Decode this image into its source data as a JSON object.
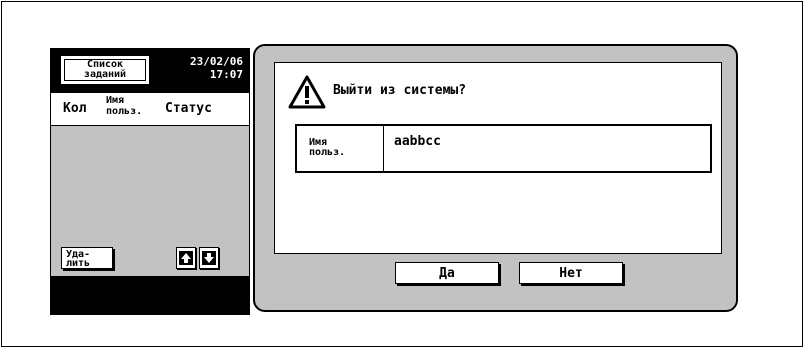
{
  "job_panel": {
    "job_list_label_line1": "Список",
    "job_list_label_line2": "заданий",
    "date": "23/02/06",
    "time": "17:07",
    "columns": {
      "count": "Кол",
      "user_line1": "Имя",
      "user_line2": "польз.",
      "status": "Статус"
    },
    "delete_line1": "Уда-",
    "delete_line2": "лить"
  },
  "dialog": {
    "message": "Выйти из системы?",
    "user_label_line1": "Имя",
    "user_label_line2": "польз.",
    "user_value": "aabbcc",
    "yes_label": "Да",
    "no_label": "Нет"
  },
  "icons": {
    "warning": "warning-icon",
    "up": "arrow-up-icon",
    "down": "arrow-down-icon"
  }
}
